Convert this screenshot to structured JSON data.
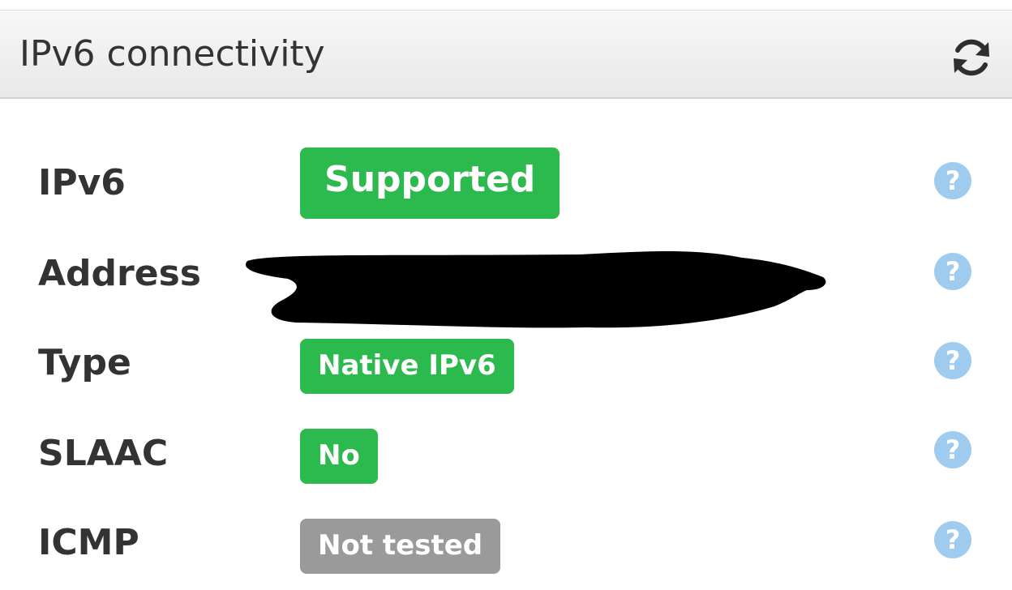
{
  "header": {
    "title": "IPv6 connectivity",
    "refresh_icon": "refresh-icon"
  },
  "rows": [
    {
      "label": "IPv6",
      "value": "Supported",
      "status_color": "#2cb94d"
    },
    {
      "label": "Address",
      "value": ""
    },
    {
      "label": "Type",
      "value": "Native IPv6",
      "status_color": "#2cb94d"
    },
    {
      "label": "SLAAC",
      "value": "No",
      "status_color": "#2cb94d"
    },
    {
      "label": "ICMP",
      "value": "Not tested",
      "status_color": "#9a9a9a"
    }
  ],
  "help_glyph": "?",
  "colors": {
    "success": "#2cb94d",
    "neutral": "#9a9a9a",
    "help": "#9fcbee"
  }
}
